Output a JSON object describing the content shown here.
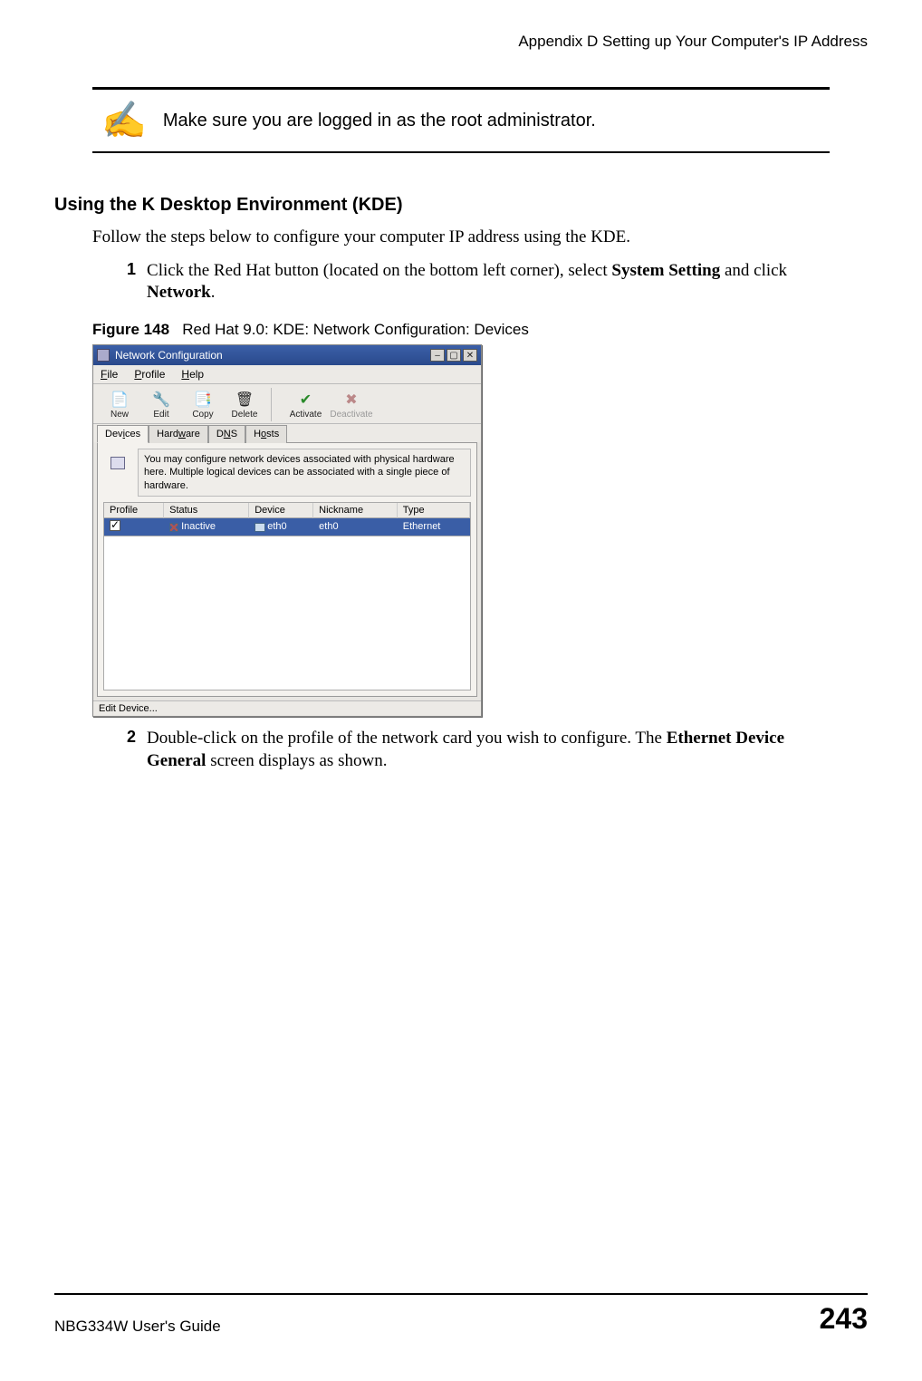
{
  "header": {
    "appendix": "Appendix D Setting up Your Computer's IP Address"
  },
  "note": {
    "text": "Make sure you are logged in as the root administrator."
  },
  "section": {
    "heading": "Using the K Desktop Environment (KDE)",
    "intro": "Follow the steps below to configure your computer IP address using the KDE."
  },
  "steps": [
    {
      "num": "1",
      "a": "Click the Red Hat button (located on the bottom left corner), select ",
      "b": "System Setting",
      "c": " and click ",
      "d": "Network",
      "e": "."
    },
    {
      "num": "2",
      "a": "Double-click on the profile of the network card you wish to configure. The ",
      "b": "Ethernet Device General",
      "c": " screen displays as shown."
    }
  ],
  "figure": {
    "num": "Figure 148",
    "title": "Red Hat 9.0: KDE: Network Configuration: Devices"
  },
  "window": {
    "title": "Network Configuration",
    "menus": [
      "ile",
      "rofile",
      "elp"
    ],
    "toolbar": [
      "ew",
      "dit",
      "Copy",
      "Delete",
      "Activate",
      "Deactivate"
    ],
    "tabs": [
      "Devices",
      "Hardware",
      "DNS",
      "Hosts"
    ],
    "hint": "You may configure network devices associated with physical hardware here. Multiple logical devices can be associated with a single piece of hardware.",
    "columns": [
      "Profile",
      "Status",
      "Device",
      "Nickname",
      "Type"
    ],
    "row": {
      "profile_checked": true,
      "status": "Inactive",
      "device": "eth0",
      "nickname": "eth0",
      "type": "Ethernet"
    },
    "status": "Edit Device..."
  },
  "footer": {
    "guide": "NBG334W User's Guide",
    "page": "243"
  }
}
